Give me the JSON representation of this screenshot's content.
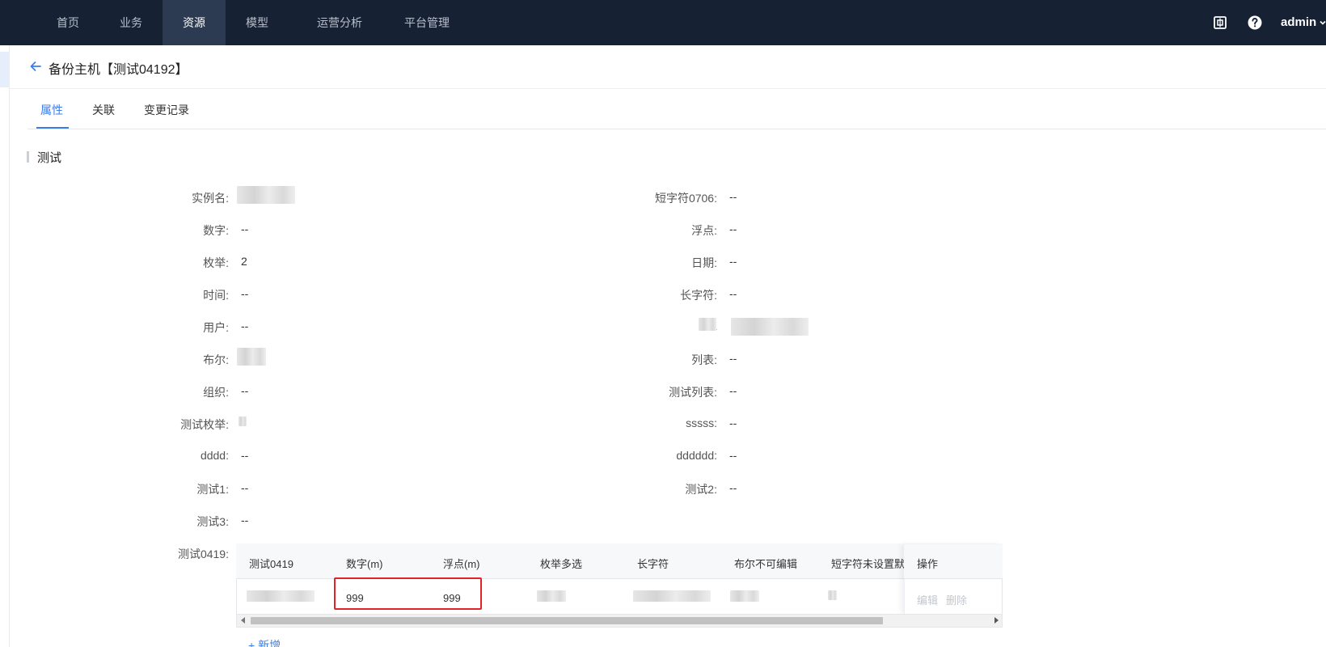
{
  "nav": {
    "items": [
      {
        "label": "首页"
      },
      {
        "label": "业务"
      },
      {
        "label": "资源",
        "active": true
      },
      {
        "label": "模型"
      },
      {
        "label": "运营分析"
      },
      {
        "label": "平台管理"
      }
    ],
    "icons": [
      "screen-share-icon",
      "help-icon"
    ],
    "user": "admin"
  },
  "header": {
    "title": "备份主机【测试04192】"
  },
  "tabs": [
    {
      "label": "属性",
      "active": true
    },
    {
      "label": "关联"
    },
    {
      "label": "变更记录"
    }
  ],
  "section": {
    "title": "测试"
  },
  "fields_left": [
    {
      "label": "实例名:",
      "value": ""
    },
    {
      "label": "数字:",
      "value": "--"
    },
    {
      "label": "枚举:",
      "value": "2"
    },
    {
      "label": "时间:",
      "value": "--"
    },
    {
      "label": "用户:",
      "value": "--"
    },
    {
      "label": "布尔:",
      "value": ""
    },
    {
      "label": "组织:",
      "value": "--"
    },
    {
      "label": "测试枚举:",
      "value": ""
    },
    {
      "label": "dddd:",
      "value": "--"
    },
    {
      "label": "测试1:",
      "value": "--"
    },
    {
      "label": "测试3:",
      "value": "--"
    }
  ],
  "fields_right": [
    {
      "label": "短字符0706:",
      "value": "--"
    },
    {
      "label": "浮点:",
      "value": "--"
    },
    {
      "label": "日期:",
      "value": "--"
    },
    {
      "label": "长字符:",
      "value": "--"
    },
    {
      "label": "E",
      "value": ""
    },
    {
      "label": "列表:",
      "value": "--"
    },
    {
      "label": "测试列表:",
      "value": "--"
    },
    {
      "label": "sssss:",
      "value": "--"
    },
    {
      "label": "dddddd:",
      "value": "--"
    },
    {
      "label": "测试2:",
      "value": "--"
    }
  ],
  "table_field": {
    "label": "测试0419:",
    "columns": [
      "测试0419",
      "数字(m)",
      "浮点(m)",
      "枚举多选",
      "长字符",
      "布尔不可编辑",
      "短字符未设置默认"
    ],
    "op_column": "操作",
    "row": {
      "number": "999",
      "float": "999"
    },
    "op_links": [
      "编辑",
      "删除"
    ],
    "add_label": "+ 新增"
  },
  "colors": {
    "nav_bg": "#172134",
    "accent": "#3b7ee8",
    "highlight": "#e0242a"
  }
}
